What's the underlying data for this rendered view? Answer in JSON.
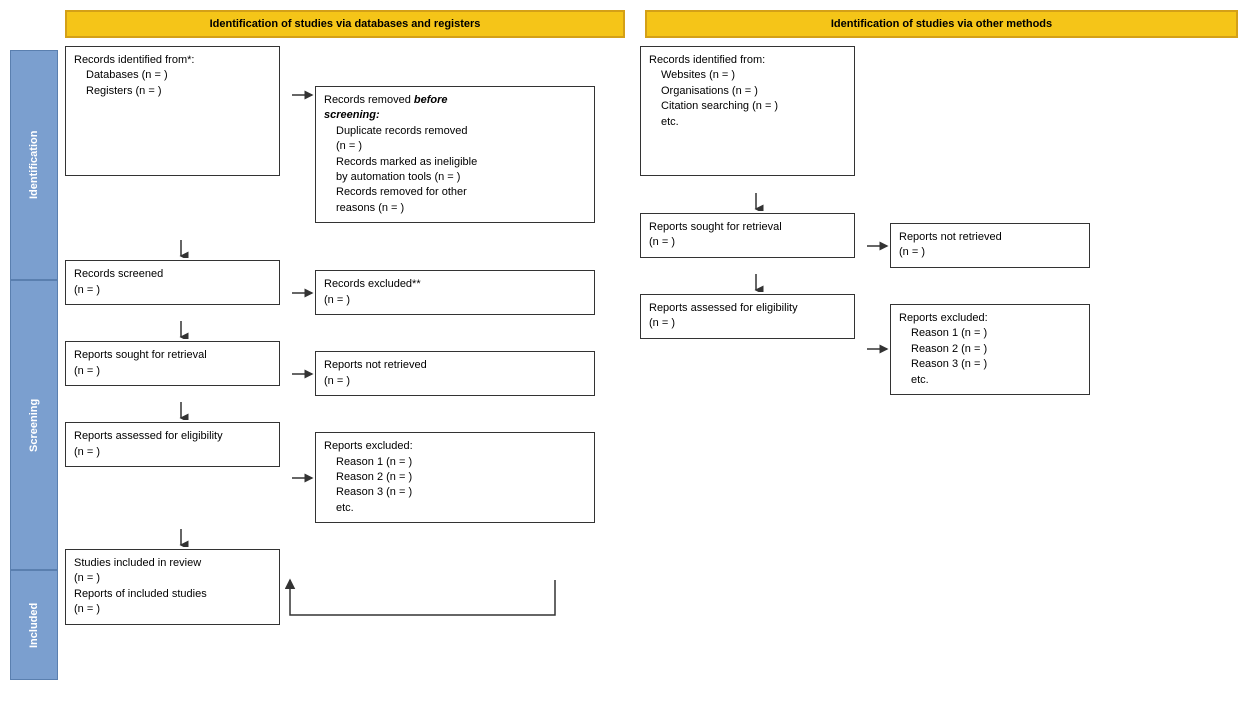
{
  "headers": {
    "left": "Identification of studies via databases and registers",
    "right": "Identification of studies via other methods"
  },
  "phases": {
    "identification": "Identification",
    "screening": "Screening",
    "included": "Included"
  },
  "left_col": {
    "id_main": {
      "line1": "Records identified from*:",
      "line2": "Databases (n = )",
      "line3": "Registers (n = )"
    },
    "id_side": {
      "line1": "Records removed before",
      "line2": "screening:",
      "line3": "Duplicate records removed",
      "line4": "(n = )",
      "line5": "Records marked as ineligible",
      "line6": "by automation tools (n = )",
      "line7": "Records removed for other",
      "line8": "reasons (n = )"
    },
    "screened_main": {
      "line1": "Records screened",
      "line2": "(n = )"
    },
    "screened_side": {
      "line1": "Records excluded**",
      "line2": "(n = )"
    },
    "retrieval_main": {
      "line1": "Reports sought for retrieval",
      "line2": "(n = )"
    },
    "retrieval_side": {
      "line1": "Reports not retrieved",
      "line2": "(n = )"
    },
    "eligibility_main": {
      "line1": "Reports assessed for eligibility",
      "line2": "(n = )"
    },
    "eligibility_side": {
      "line1": "Reports excluded:",
      "line2": "Reason 1 (n = )",
      "line3": "Reason 2 (n = )",
      "line4": "Reason 3 (n = )",
      "line5": "etc."
    },
    "included_main": {
      "line1": "Studies included in review",
      "line2": "(n = )",
      "line3": "Reports of included studies",
      "line4": "(n = )"
    }
  },
  "right_col": {
    "id_main": {
      "line1": "Records identified from:",
      "line2": "Websites (n = )",
      "line3": "Organisations (n = )",
      "line4": "Citation searching (n = )",
      "line5": "etc."
    },
    "retrieval_main": {
      "line1": "Reports sought for retrieval",
      "line2": "(n = )"
    },
    "retrieval_side": {
      "line1": "Reports not retrieved",
      "line2": "(n = )"
    },
    "eligibility_main": {
      "line1": "Reports assessed for eligibility",
      "line2": "(n = )"
    },
    "eligibility_side": {
      "line1": "Reports excluded:",
      "line2": "Reason 1 (n = )",
      "line3": "Reason 2 (n = )",
      "line4": "Reason 3 (n = )",
      "line5": "etc."
    }
  },
  "colors": {
    "phase_bg": "#7b9fcf",
    "header_bg": "#f5c518",
    "box_border": "#333333",
    "arrow_color": "#333333"
  }
}
